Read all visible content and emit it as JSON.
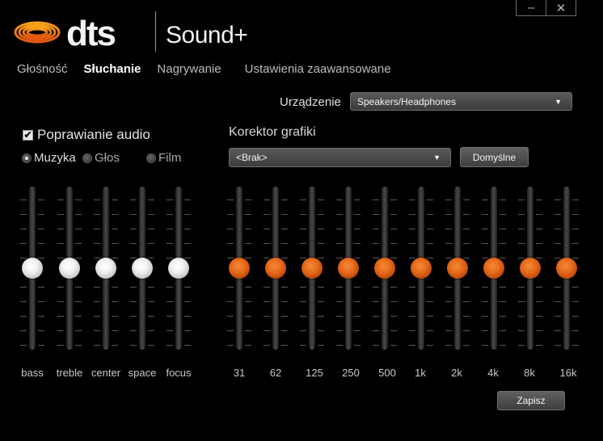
{
  "window": {
    "minimize_glyph": "–",
    "close_glyph": "✕"
  },
  "brand": {
    "logo_text": "dts",
    "product": "Sound+"
  },
  "tabs": [
    {
      "label": "Głośność",
      "active": false
    },
    {
      "label": "Słuchanie",
      "active": true
    },
    {
      "label": "Nagrywanie",
      "active": false
    },
    {
      "label": "Ustawienia zaawansowane",
      "active": false
    }
  ],
  "device": {
    "label": "Urządzenie",
    "value": "Speakers/Headphones"
  },
  "enhancement": {
    "checkbox_label": "Poprawianie audio",
    "checked": true,
    "modes": [
      {
        "label": "Muzyka",
        "selected": true
      },
      {
        "label": "Głos",
        "selected": false
      },
      {
        "label": "Film",
        "selected": false
      }
    ]
  },
  "tone_sliders": [
    {
      "label": "bass",
      "level": 0.5
    },
    {
      "label": "treble",
      "level": 0.5
    },
    {
      "label": "center",
      "level": 0.5
    },
    {
      "label": "space",
      "level": 0.5
    },
    {
      "label": "focus",
      "level": 0.5
    }
  ],
  "equalizer": {
    "title": "Korektor grafiki",
    "preset": "<Brak>",
    "default_button": "Domyślne",
    "bands": [
      {
        "label": "31",
        "level": 0.5
      },
      {
        "label": "62",
        "level": 0.5
      },
      {
        "label": "125",
        "level": 0.5
      },
      {
        "label": "250",
        "level": 0.5
      },
      {
        "label": "500",
        "level": 0.5
      },
      {
        "label": "1k",
        "level": 0.5
      },
      {
        "label": "2k",
        "level": 0.5
      },
      {
        "label": "4k",
        "level": 0.5
      },
      {
        "label": "8k",
        "level": 0.5
      },
      {
        "label": "16k",
        "level": 0.5
      }
    ]
  },
  "save_button": "Zapisz",
  "colors": {
    "accent": "#e86a1a",
    "logo_orange": "#f08a1a",
    "background": "#000000"
  },
  "icons": {
    "dropdown_caret": "▼",
    "check_mark": "✔"
  }
}
